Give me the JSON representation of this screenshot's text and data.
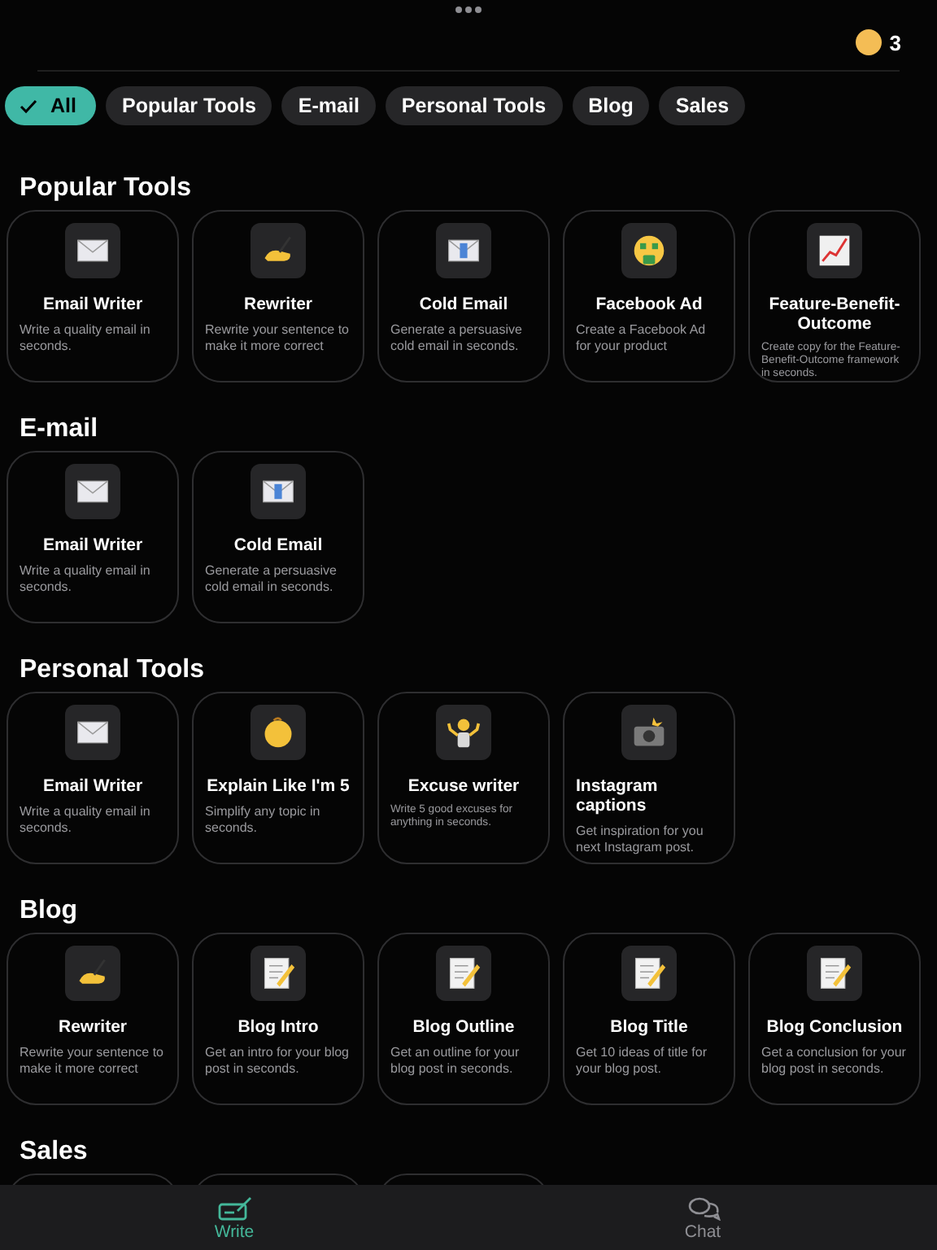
{
  "header": {
    "coins": "3"
  },
  "filters": [
    {
      "label": "All",
      "selected": true
    },
    {
      "label": "Popular Tools",
      "selected": false
    },
    {
      "label": "E-mail",
      "selected": false
    },
    {
      "label": "Personal Tools",
      "selected": false
    },
    {
      "label": "Blog",
      "selected": false
    },
    {
      "label": "Sales",
      "selected": false
    }
  ],
  "sections": [
    {
      "title": "Popular Tools",
      "cards": [
        {
          "kind": "envelope",
          "title": "Email Writer",
          "description": "Write a quality email in seconds."
        },
        {
          "kind": "writing",
          "title": "Rewriter",
          "description": "Rewrite your sentence to make it more correct"
        },
        {
          "kind": "incoming",
          "title": "Cold Email",
          "description": "Generate a persuasive cold email in seconds."
        },
        {
          "kind": "money",
          "title": "Facebook Ad",
          "description": "Create a Facebook Ad for your product"
        },
        {
          "kind": "chart",
          "title": "Feature-Benefit-Outcome",
          "description": "Create copy for the Feature-Benefit-Outcome framework in seconds.",
          "small": true
        }
      ]
    },
    {
      "title": "E-mail",
      "cards": [
        {
          "kind": "envelope",
          "title": "Email Writer",
          "description": "Write a quality email in seconds."
        },
        {
          "kind": "incoming",
          "title": "Cold Email",
          "description": "Generate a persuasive cold email in seconds."
        }
      ]
    },
    {
      "title": "Personal Tools",
      "cards": [
        {
          "kind": "envelope",
          "title": "Email Writer",
          "description": "Write a quality email in seconds."
        },
        {
          "kind": "baby",
          "title": "Explain Like I'm 5",
          "description": "Simplify any topic in seconds."
        },
        {
          "kind": "shrug",
          "title": "Excuse writer",
          "description": "Write 5 good excuses for anything in seconds.",
          "small": true
        },
        {
          "kind": "camera",
          "title": "Instagram captions",
          "description": "Get inspiration for you next Instagram post.",
          "left": true
        }
      ]
    },
    {
      "title": "Blog",
      "cards": [
        {
          "kind": "writing",
          "title": "Rewriter",
          "description": "Rewrite your sentence to make it more correct"
        },
        {
          "kind": "memo",
          "title": "Blog Intro",
          "description": "Get an intro for your blog post in seconds."
        },
        {
          "kind": "memo",
          "title": "Blog Outline",
          "description": "Get an outline for your blog post in seconds."
        },
        {
          "kind": "memo",
          "title": "Blog Title",
          "description": "Get 10 ideas of title for your blog post."
        },
        {
          "kind": "memo",
          "title": "Blog Conclusion",
          "description": "Get a conclusion for your blog post in seconds."
        }
      ]
    },
    {
      "title": "Sales",
      "cards": [
        {
          "kind": "blank"
        },
        {
          "kind": "blank"
        },
        {
          "kind": "blank"
        }
      ]
    }
  ],
  "tab_bar": [
    {
      "label": "Write",
      "kind": "write",
      "selected": true
    },
    {
      "label": "Chat",
      "kind": "chat",
      "selected": false
    }
  ]
}
